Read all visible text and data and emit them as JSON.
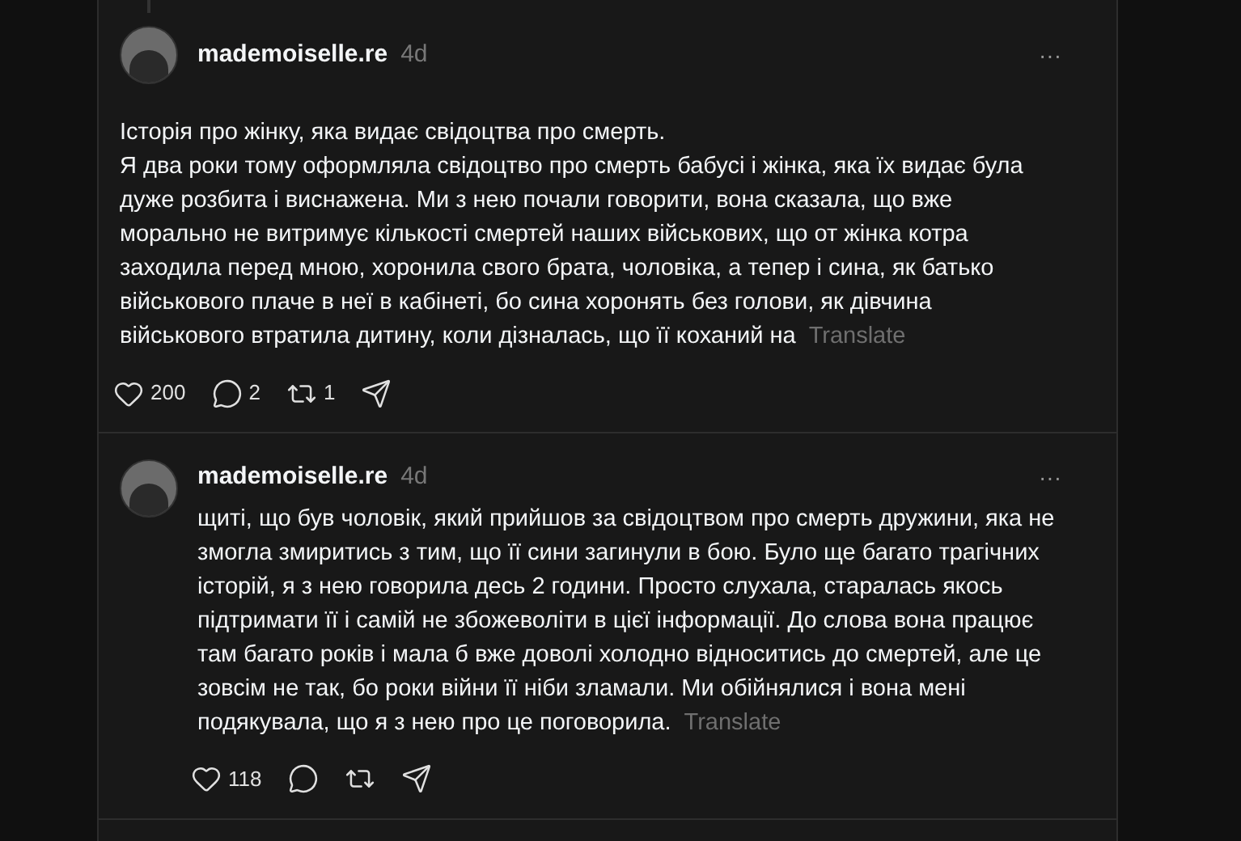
{
  "posts": [
    {
      "kind": "full",
      "author": "mademoiselle.re",
      "time": "4d",
      "more": "···",
      "text": "Історія про жінку, яка видає свідоцтва про смерть.\nЯ два роки тому оформляла свідоцтво про смерть бабусі і жінка, яка їх видає була дуже розбита і виснажена. Ми з нею почали говорити, вона сказала, що вже морально не витримує кількості смертей наших військових, що от жінка котра заходила перед мною, хоронила свого брата, чоловіка, а тепер і сина, як батько військового плаче в неї в кабінеті, бо сина хоронять без голови, як дівчина військового втратила дитину, коли дізналась, що її коханий на",
      "translate": "Translate",
      "likes": "200",
      "replies": "2",
      "reposts": "1"
    },
    {
      "kind": "indented",
      "author": "mademoiselle.re",
      "time": "4d",
      "more": "···",
      "text": "щиті, що був чоловік, який прийшов за свідоцтвом про смерть дружини, яка не змогла змиритись з тим, що її сини загинули в бою. Було ще багато трагічних історій, я з нею говорила десь 2 години. Просто слухала, старалась якось підтримати її і самій не збожеволіти в цієї інформації. До слова вона працює там багато років і мала б вже доволі холодно відноситись до смертей, але це зовсім не так, бо роки війни її ніби зламали. Ми обійнялися і вона мені подякувала, що я з нею про це поговорила.",
      "translate": "Translate",
      "likes": "118"
    }
  ]
}
